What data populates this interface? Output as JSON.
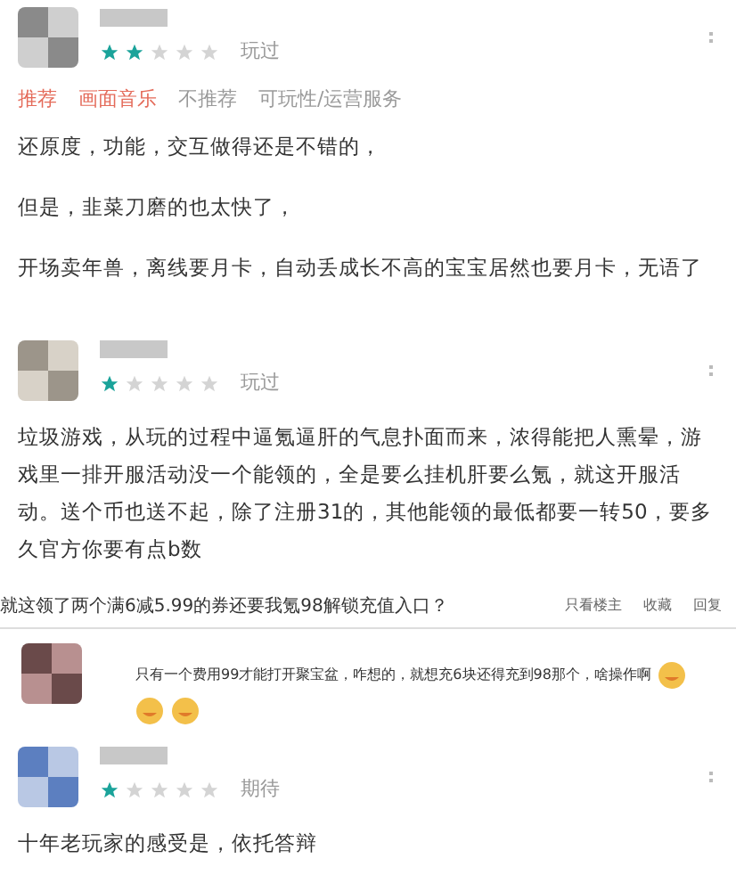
{
  "reviews": [
    {
      "stars": 2,
      "status": "玩过",
      "tags": [
        "推荐",
        "画面音乐",
        "不推荐",
        "可玩性/运营服务"
      ],
      "paragraphs": [
        "还原度，功能，交互做得还是不错的，",
        "但是，韭菜刀磨的也太快了，",
        "开场卖年兽，离线要月卡，自动丢成长不高的宝宝居然也要月卡，无语了"
      ]
    },
    {
      "stars": 1,
      "status": "玩过",
      "paragraphs": [
        "垃圾游戏，从玩的过程中逼氪逼肝的气息扑面而来，浓得能把人熏晕，游戏里一排开服活动没一个能领的，全是要么挂机肝要么氪，就这开服活动。送个币也送不起，除了注册31的，其他能领的最低都要一转50，要多久官方你要有点b数"
      ]
    }
  ],
  "thread": {
    "title": "就这领了两个满6减5.99的券还要我氪98解锁充值入口？",
    "actions": [
      "只看楼主",
      "收藏",
      "回复"
    ],
    "reply": "只有一个费用99才能打开聚宝盆，咋想的，就想充6块还得充到98那个，啥操作啊"
  },
  "last_review": {
    "stars": 1,
    "status": "期待",
    "paragraphs": [
      "十年老玩家的感受是，依托答辩"
    ]
  }
}
